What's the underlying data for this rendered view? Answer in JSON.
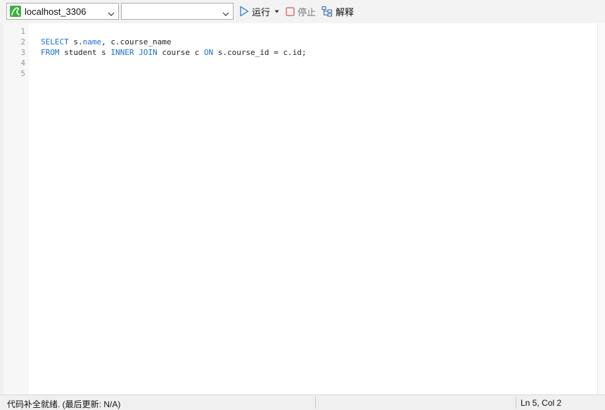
{
  "toolbar": {
    "connection": {
      "value": "localhost_3306",
      "icon": "mysql-connection-icon"
    },
    "database": {
      "value": ""
    },
    "run_label": "运行",
    "stop_label": "停止",
    "explain_label": "解释"
  },
  "editor": {
    "line_numbers": [
      "1",
      "2",
      "3",
      "4",
      "5"
    ],
    "lines": [
      {
        "segments": []
      },
      {
        "segments": [
          {
            "text": "SELECT",
            "kw": true
          },
          {
            "text": " s.",
            "kw": false
          },
          {
            "text": "name",
            "kw": true
          },
          {
            "text": ", c.course_name",
            "kw": false
          }
        ]
      },
      {
        "segments": [
          {
            "text": "FROM",
            "kw": true
          },
          {
            "text": " student s ",
            "kw": false
          },
          {
            "text": "INNER JOIN",
            "kw": true
          },
          {
            "text": " course c ",
            "kw": false
          },
          {
            "text": "ON",
            "kw": true
          },
          {
            "text": " s.course_id = c.id;",
            "kw": false
          }
        ]
      },
      {
        "segments": []
      },
      {
        "segments": []
      }
    ]
  },
  "status": {
    "left_text": "代码补全就绪. (最后更新: N/A)",
    "cursor": "Ln 5, Col 2"
  },
  "colors": {
    "keyword": "#1a6fd1",
    "run_icon": "#3a86d8",
    "stop_icon": "#e05050"
  }
}
